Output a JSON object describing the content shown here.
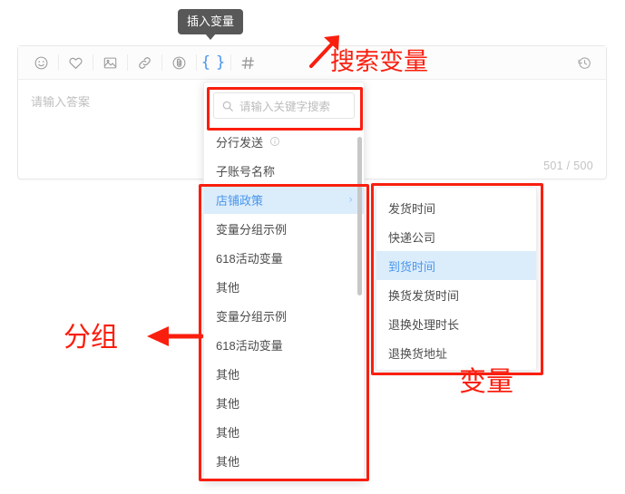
{
  "tooltip": {
    "label": "插入变量"
  },
  "toolbar": {
    "items": [
      {
        "name": "emoji-icon",
        "glyph": "☺",
        "active": false
      },
      {
        "name": "heart-icon",
        "glyph": "♡",
        "active": false
      },
      {
        "name": "image-icon",
        "glyph": "▨",
        "active": false
      },
      {
        "name": "link-icon",
        "glyph": "🔗",
        "active": false
      },
      {
        "name": "attachment-icon",
        "glyph": "◍",
        "active": false
      },
      {
        "name": "braces-icon",
        "glyph": "{ }",
        "active": true
      },
      {
        "name": "hash-icon",
        "glyph": "#",
        "active": false
      }
    ],
    "history_icon": "history-icon"
  },
  "editor": {
    "placeholder": "请输入答案",
    "counter": "501 / 500",
    "counter_current": 501,
    "counter_max": 500
  },
  "dropdown": {
    "search": {
      "placeholder": "请输入关键字搜索",
      "value": "",
      "icon": "search-icon"
    },
    "items": [
      {
        "label": "分行发送",
        "info": true,
        "submenu": false,
        "selected": false
      },
      {
        "label": "子账号名称",
        "info": false,
        "submenu": false,
        "selected": false
      },
      {
        "label": "店铺政策",
        "info": false,
        "submenu": true,
        "selected": true
      },
      {
        "label": "变量分组示例",
        "info": false,
        "submenu": false,
        "selected": false
      },
      {
        "label": "618活动变量",
        "info": false,
        "submenu": false,
        "selected": false
      },
      {
        "label": "其他",
        "info": false,
        "submenu": false,
        "selected": false
      },
      {
        "label": "变量分组示例",
        "info": false,
        "submenu": false,
        "selected": false
      },
      {
        "label": "618活动变量",
        "info": false,
        "submenu": false,
        "selected": false
      },
      {
        "label": "其他",
        "info": false,
        "submenu": false,
        "selected": false
      },
      {
        "label": "其他",
        "info": false,
        "submenu": false,
        "selected": false
      },
      {
        "label": "其他",
        "info": false,
        "submenu": false,
        "selected": false
      },
      {
        "label": "其他",
        "info": false,
        "submenu": false,
        "selected": false
      }
    ],
    "chevron": "›"
  },
  "submenu": {
    "items": [
      {
        "label": "发货时间",
        "selected": false
      },
      {
        "label": "快递公司",
        "selected": false
      },
      {
        "label": "到货时间",
        "selected": true
      },
      {
        "label": "换货发货时间",
        "selected": false
      },
      {
        "label": "退换处理时长",
        "selected": false
      },
      {
        "label": "退换货地址",
        "selected": false
      }
    ]
  },
  "annotations": {
    "color": "#fa1e0e",
    "search_label": "搜索变量",
    "group_label": "分组",
    "variable_label": "变量"
  }
}
